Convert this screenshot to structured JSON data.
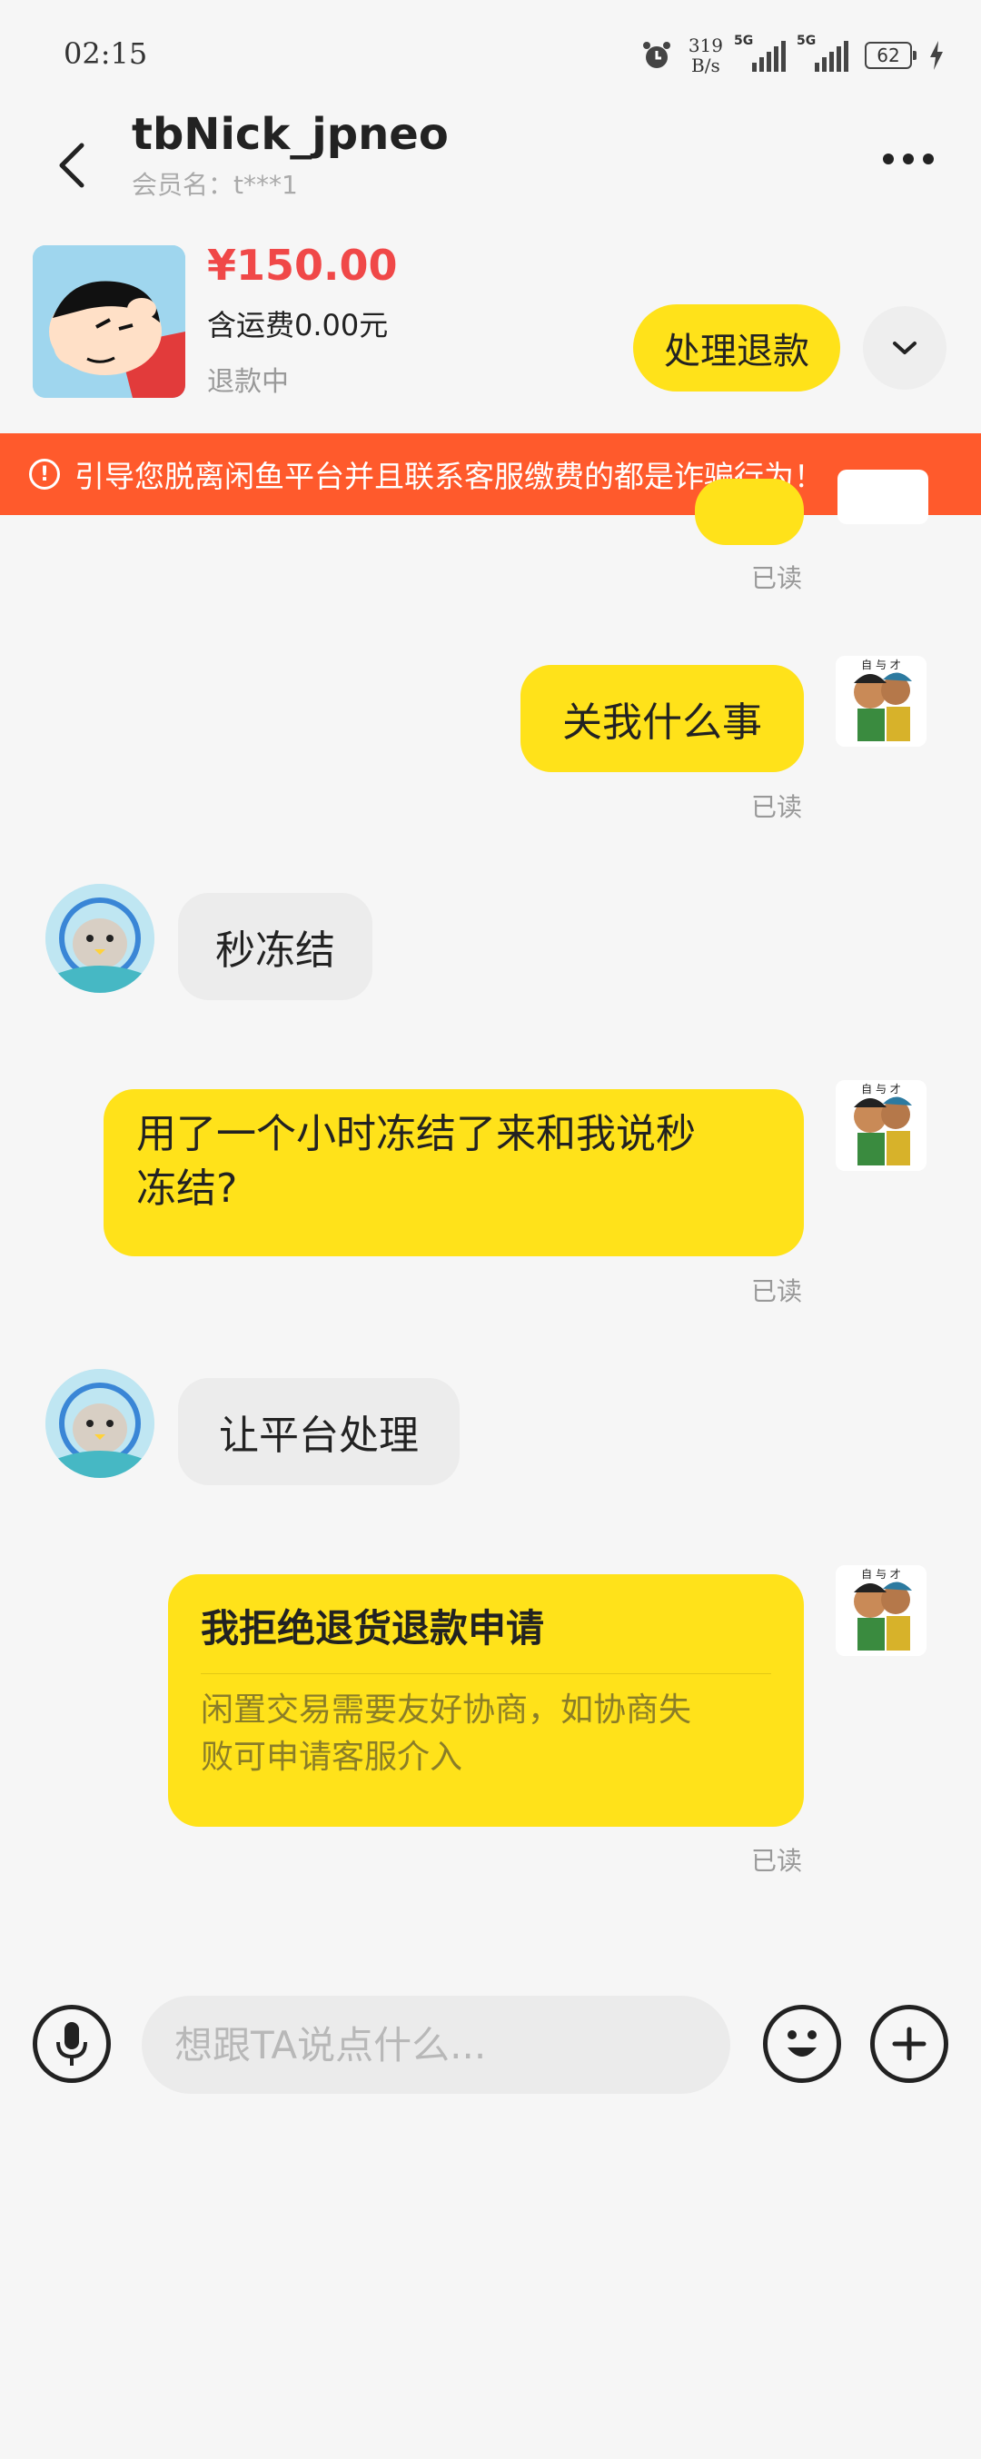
{
  "status_bar": {
    "time": "02:15",
    "net_speed_value": "319",
    "net_speed_unit": "B/s",
    "signal1_label": "5G",
    "signal2_label": "5G",
    "battery": "62"
  },
  "header": {
    "nickname": "tbNick_jpneo",
    "member_name": "会员名：t***1"
  },
  "product": {
    "price": "¥150.00",
    "shipping": "含运费0.00元",
    "refund_status": "退款中",
    "refund_button": "处理退款"
  },
  "warning": {
    "text": "引导您脱离闲鱼平台并且联系客服缴费的都是诈骗行为！"
  },
  "messages": [
    {
      "sender": "me",
      "text": "",
      "read": "已读"
    },
    {
      "sender": "me",
      "text": "关我什么事",
      "read": "已读"
    },
    {
      "sender": "other",
      "text": "秒冻结"
    },
    {
      "sender": "me",
      "line1": "用了一个小时冻结了来和我说秒",
      "line2": "冻结?",
      "read": "已读"
    },
    {
      "sender": "other",
      "text": "让平台处理"
    },
    {
      "sender": "me",
      "card_title": "我拒绝退货退款申请",
      "card_line1": "闲置交易需要友好协商，如协商失",
      "card_line2": "败可申请客服介入",
      "read": "已读"
    }
  ],
  "input": {
    "placeholder": "想跟TA说点什么..."
  },
  "colors": {
    "accent_yellow": "#ffe21a",
    "warning_orange": "#ff5a2c",
    "price_red": "#f04848"
  },
  "icons": [
    "back-arrow-icon",
    "more-dots-icon",
    "chevron-down-icon",
    "warning-circle-icon",
    "microphone-icon",
    "emoji-icon",
    "plus-icon"
  ]
}
